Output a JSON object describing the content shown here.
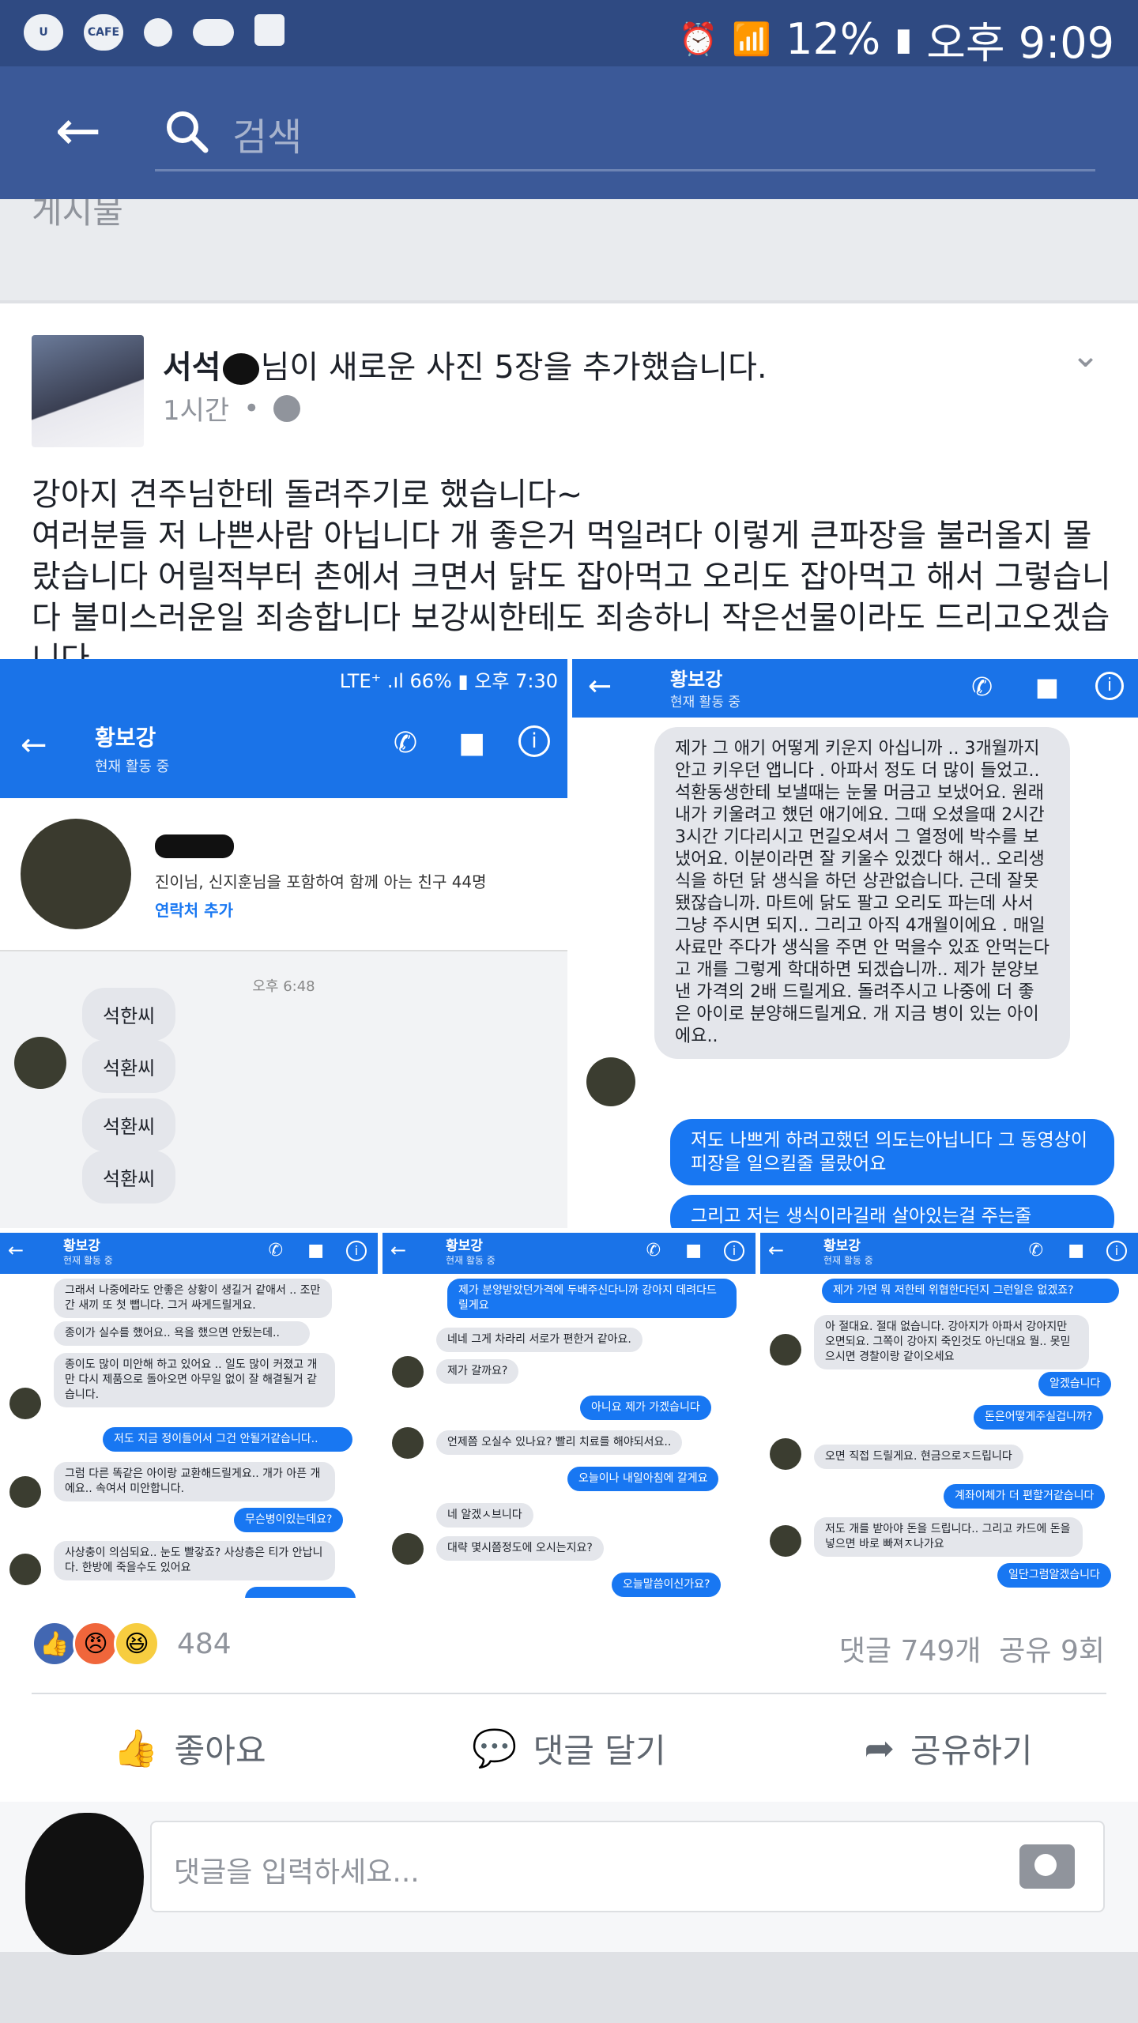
{
  "status_bar": {
    "battery": "12%",
    "time": "오후 9:09",
    "cafe_label": "CAFE"
  },
  "search": {
    "placeholder": "검색"
  },
  "previous_section": {
    "label": "게시물"
  },
  "post": {
    "author": "서석",
    "action": "님이 새로운 사진 5장을 추가했습니다.",
    "time": "1시간",
    "dot": "•",
    "text": "강아지 견주님한테 돌려주기로 했습니다~\n여러분들 저 나쁜사람 아닙니다 개 좋은거 먹일려다 이렇게 큰파장을 불러올지 몰랐습니다 어릴적부터 촌에서 크면서 닭도 잡아먹고 오리도 잡아먹고 해서 그렇습니다 불미스러운일 죄송합니다 보강씨한테도 죄송하니 작은선물이라도 드리고오겠습니다."
  },
  "photos": {
    "p1": {
      "status": "LTE⁺ .ıl 66% ▮ 오후 7:30",
      "name": "황보강",
      "sub": "현재 활동 중",
      "mutual": "진이님, 신지훈님을 포함하여 함께 아는 친구 44명",
      "add_contact": "연락처 추가",
      "time": "오후 6:48",
      "m1": "석한씨",
      "m2": "석환씨",
      "m3": "석환씨",
      "m4": "석환씨"
    },
    "p2": {
      "name": "황보강",
      "sub": "현재 활동 중",
      "long": "제가 그 애기 어떻게 키운지 아십니까 .. 3개월까지 안고 키우던 앱니다 . 아파서 정도 더 많이 들었고.. 석환동생한테 보낼때는 눈물 머금고 보냈어요. 원래 내가 키울려고 했던 애기에요. 그때 오셨을때 2시간 3시간 기다리시고 먼길오셔서 그 열정에 박수를 보냈어요. 이분이라면 잘 키울수 있겠다 해서.. 오리생식을 하던 닭 생식을 하던 상관없습니다. 근데 잘못됐잖습니까. 마트에 닭도 팔고 오리도 파는데 사서 그냥 주시면 되지.. 그리고 아직 4개월이에요 . 매일 사료만 주다가 생식을 주면 안 먹을수 있죠 안먹는다고 개를 그렇게 학대하면 되겠습니까.. 제가 분양보낸 가격의 2배 드릴게요. 돌려주시고 나중에 더 좋은 아이로 분양해드릴게요. 개 지금 병이 있는 아이에요..",
      "out1": "저도 나쁘게 하려고했던 의도는아닙니다 그 동영상이 피장을 일으킬줄 몰랐어요",
      "out2": "그리고 저는 생식이라길래 살아있는걸 주는줄"
    },
    "p3": {
      "name": "황보강",
      "sub": "현재 활동 중",
      "m1": "그래서 나중에라도 안좋은 상황이 생길거 같애서 .. 조만간 새끼 또 첫 뺍니다. 그거 싸게드릴게요.",
      "m2": "종이가 실수를 했어요.. 욕을 했으면 안됬는데..",
      "m3": "종이도 많이 미안해 하고 있어요 .. 일도 많이 커졌고 개만 다시 제품으로 돌아오면 아무일 없이 잘 해결될거 같습니다.",
      "o1": "저도 지금 정이들어서 그건 안될거같습니다..",
      "m4": "그럼 다른 똑같은 아이랑 교환해드릴게요.. 개가 아픈 개 에요.. 속여서 미안합니다.",
      "o2": "무슨병이있는데요?",
      "m5": "사상충이 의심되요.. 눈도 빨갛죠? 사상층은 티가 안납니다. 한방에 죽을수도 있어요"
    },
    "p4": {
      "name": "황보강",
      "sub": "현재 활동 중",
      "o1": "제가 분양받았던가격에 두배주신다니까 강아지 데려다드릴게요",
      "m1": "네네 그게 차라리 서로가 편한거 같아요.",
      "m2": "제가 갈까요?",
      "o2": "아니요 제가 가겠습니다",
      "m3": "언제쯤 오실수 있나요? 빨리 치료를 해야되서요..",
      "o3": "오늘이나 내일아침에 갈게요",
      "m4": "네 알겠ㅅ브니다",
      "m5": "대략 몇시쯤정도에 오시는지요?",
      "o4": "오늘말씀이신가요?"
    },
    "p5": {
      "name": "황보강",
      "sub": "현재 활동 중",
      "o1": "제가 가면 뭐 저한테 위협한다던지 그런일은 없겠죠?",
      "m1": "아 절대요. 절대 없습니다. 강아지가 아파서 강아지만 오면되요. 그쪽이 강아지 죽인것도 아닌대요 뭘.. 못믿으시면 경찰이랑 같이오세요",
      "o2": "알겠습니다",
      "o3": "돈은어떻게주실겁니까?",
      "m2": "오면 직접 드릴게요. 현금으로ㅈ드립니다",
      "o4": "계좌이체가 더 편할거같습니다",
      "m3": "저도 개를 받아야 돈을 드립니다.. 그리고 카드에 돈을 넣으면 바로 빠져ㅈ나가요",
      "o5": "일단그럼알겠습니다"
    }
  },
  "reactions": {
    "count": "484",
    "comments": "댓글 749개",
    "shares": "공유 9회"
  },
  "actions": {
    "like": "좋아요",
    "comment": "댓글 달기",
    "share": "공유하기"
  },
  "comment_input": {
    "placeholder": "댓글을 입력하세요..."
  },
  "colors": {
    "facebook_blue": "#3b5998",
    "messenger_blue": "#1877f2",
    "status_bar": "#2f4a82"
  }
}
